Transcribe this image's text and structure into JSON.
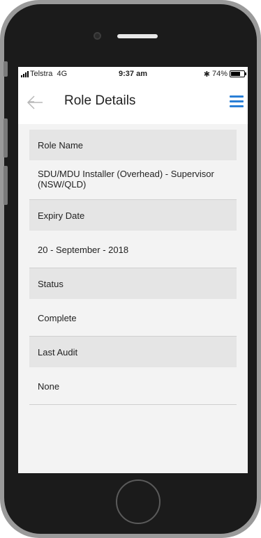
{
  "status_bar": {
    "carrier": "Telstra",
    "network": "4G",
    "time": "9:37 am",
    "bluetooth": "✱",
    "battery": "74%",
    "battery_level": 0.74
  },
  "nav": {
    "title": "Role Details",
    "back_icon": "arrow-left-icon",
    "menu_icon": "hamburger-menu-icon",
    "accent_color": "#2a7fd6"
  },
  "details": [
    {
      "label": "Role Name",
      "value": "SDU/MDU Installer (Overhead) - Supervisor (NSW/QLD)"
    },
    {
      "label": "Expiry Date",
      "value": "20 - September - 2018"
    },
    {
      "label": "Status",
      "value": "Complete"
    },
    {
      "label": "Last Audit",
      "value": "None"
    }
  ]
}
